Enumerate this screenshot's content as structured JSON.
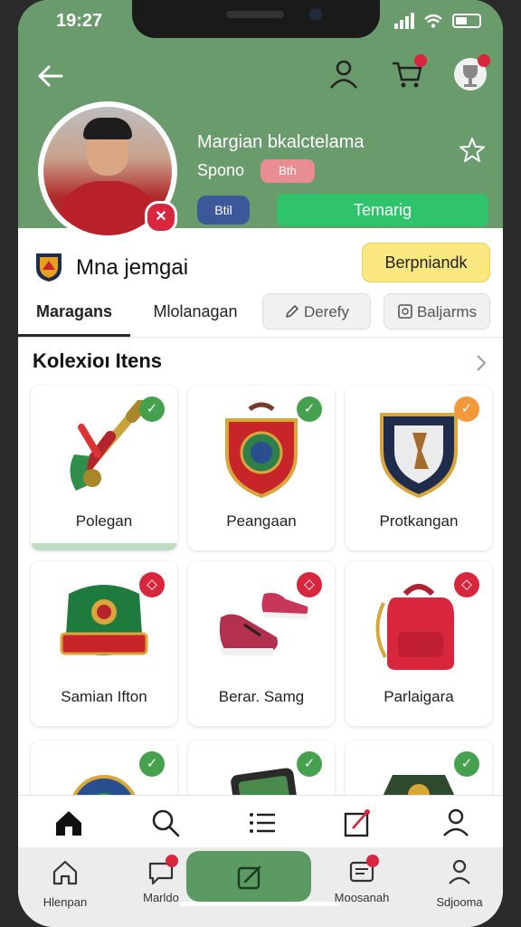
{
  "status_bar": {
    "time": "19:27"
  },
  "profile": {
    "name": "Margian bkalctelama",
    "subtitle": "Spono",
    "pill_label": "Bth",
    "badge_glyph": "✕",
    "small_button": "Btil",
    "primary_button": "Temarig"
  },
  "team": {
    "name": "Mna jemgai",
    "action_button": "Berpniandk"
  },
  "tabs": [
    {
      "label": "Maragans",
      "active": true
    },
    {
      "label": "Mlolanagan"
    },
    {
      "label": "Derefy",
      "icon": "pencil-icon"
    },
    {
      "label": "Baljarms",
      "icon": "square-icon"
    }
  ],
  "collection": {
    "title": "Kolexioı Itens",
    "items": [
      {
        "label": "Polegan",
        "badge_color": "#45a14d",
        "icon": "vuvuzela-icon"
      },
      {
        "label": "Peangaan",
        "badge_color": "#45a14d",
        "icon": "red-shield-badge-icon"
      },
      {
        "label": "Protkangan",
        "badge_color": "#f29a3b",
        "icon": "navy-crest-icon"
      },
      {
        "label": "Samian Ifton",
        "badge_color": "#d7263d",
        "icon": "green-scarf-icon"
      },
      {
        "label": "Berar. Samg",
        "badge_color": "#d7263d",
        "icon": "sneakers-icon"
      },
      {
        "label": "Parlaigara",
        "badge_color": "#d7263d",
        "icon": "red-backpack-icon"
      },
      {
        "label": "",
        "badge_color": "#45a14d",
        "icon": "blue-medal-icon"
      },
      {
        "label": "",
        "badge_color": "#45a14d",
        "icon": "tablet-icon"
      },
      {
        "label": "",
        "badge_color": "#45a14d",
        "icon": "dark-green-badge-icon"
      }
    ]
  },
  "bottom_nav": [
    {
      "label": "Hlenpan",
      "icon": "home-icon"
    },
    {
      "label": "Marldo",
      "icon": "chat-icon",
      "badge": true
    },
    {
      "label": "",
      "icon": "edit-icon",
      "active": true
    },
    {
      "label": "Moosanah",
      "icon": "message-icon",
      "badge": true
    },
    {
      "label": "Sdjooma",
      "icon": "person-icon"
    }
  ],
  "colors": {
    "header": "#6a9b6c",
    "primary_green": "#2fc46b",
    "badge_red": "#d7263d"
  }
}
